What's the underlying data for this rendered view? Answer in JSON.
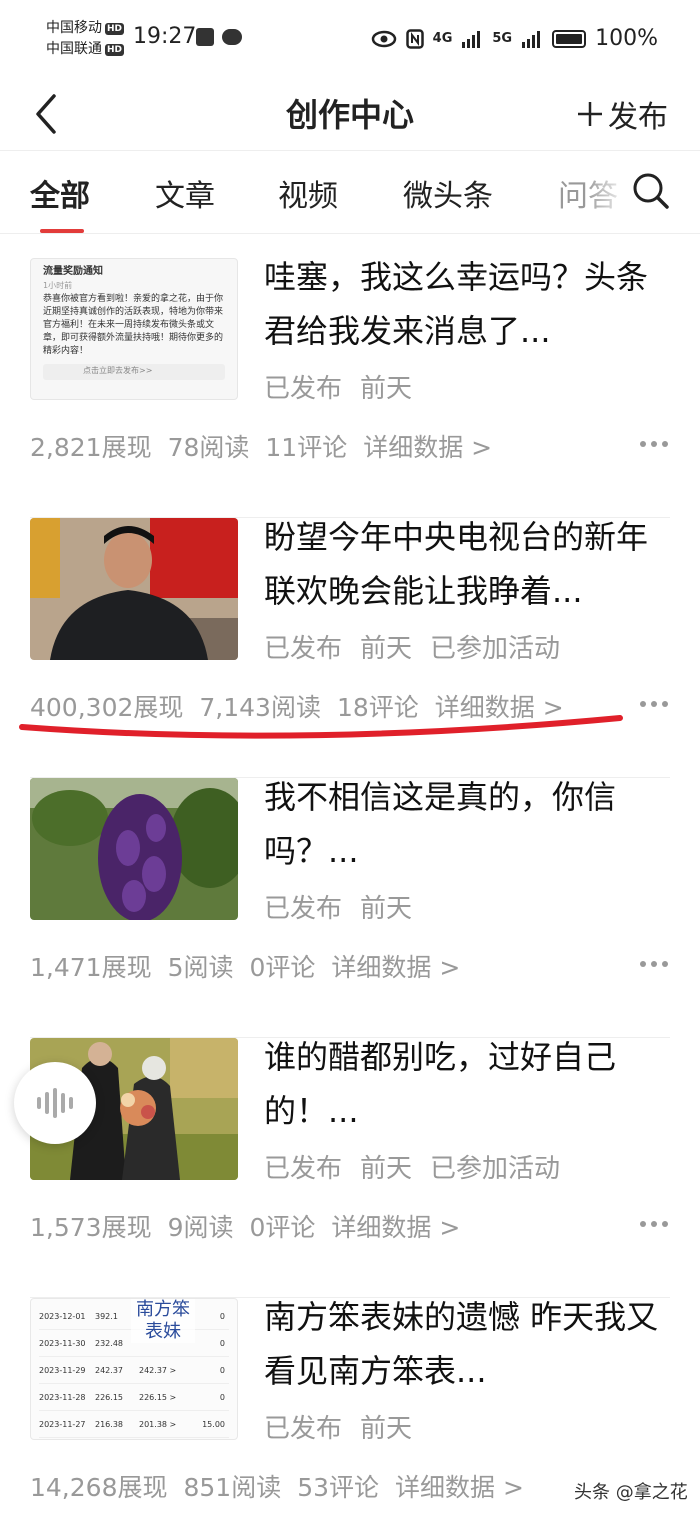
{
  "status_bar": {
    "carrier1": "中国移动",
    "carrier2": "中国联通",
    "hd": "HD",
    "time": "19:27",
    "net1": "4G",
    "net2": "5G",
    "battery": "100%"
  },
  "nav": {
    "title": "创作中心",
    "publish_label": "发布"
  },
  "tabs": [
    {
      "label": "全部"
    },
    {
      "label": "文章"
    },
    {
      "label": "视频"
    },
    {
      "label": "微头条"
    },
    {
      "label": "问答"
    }
  ],
  "articles": [
    {
      "title": "哇塞，我这么幸运吗？头条君给我发来消息了...",
      "status": "已发布",
      "time": "前天",
      "activity": "",
      "views": "2,821展现",
      "reads": "78阅读",
      "comments": "11评论",
      "detail": "详细数据 >",
      "thumb": {
        "notice_title": "流量奖励通知",
        "notice_time": "1小时前",
        "notice_body": "恭喜你被官方看到啦！亲爱的拿之花，由于你近期坚持真诚创作的活跃表现，特地为你带来官方福利！在未来一周持续发布微头条或文章，即可获得额外流量扶持哦！期待你更多的精彩内容！",
        "notice_link": "点击立即去发布>>"
      }
    },
    {
      "title": "盼望今年中央电视台的新年联欢晚会能让我睁着...",
      "status": "已发布",
      "time": "前天",
      "activity": "已参加活动",
      "views": "400,302展现",
      "reads": "7,143阅读",
      "comments": "18评论",
      "detail": "详细数据 >"
    },
    {
      "title": "我不相信这是真的，你信吗？...",
      "status": "已发布",
      "time": "前天",
      "activity": "",
      "views": "1,471展现",
      "reads": "5阅读",
      "comments": "0评论",
      "detail": "详细数据 >"
    },
    {
      "title": "谁的醋都别吃，过好自己的！...",
      "status": "已发布",
      "time": "前天",
      "activity": "已参加活动",
      "views": "1,573展现",
      "reads": "9阅读",
      "comments": "0评论",
      "detail": "详细数据 >"
    },
    {
      "title": "南方笨表妹的遗憾 昨天我又看见南方笨表...",
      "status": "已发布",
      "time": "前天",
      "activity": "",
      "views": "14,268展现",
      "reads": "851阅读",
      "comments": "53评论",
      "detail": "详细数据 >",
      "thumb": {
        "overlay": "南方笨表妹",
        "rows": [
          [
            "2023-12-01",
            "392.1",
            "",
            "0"
          ],
          [
            "2023-11-30",
            "232.48",
            "",
            "0"
          ],
          [
            "2023-11-29",
            "242.37",
            "242.37 >",
            "0"
          ],
          [
            "2023-11-28",
            "226.15",
            "226.15 >",
            "0"
          ],
          [
            "2023-11-27",
            "216.38",
            "201.38 >",
            "15.00"
          ]
        ]
      }
    }
  ],
  "watermark": "头条 @拿之花",
  "colors": {
    "accent": "#e23c3a",
    "annotation": "#e0202a",
    "meta_gray": "#999999"
  }
}
